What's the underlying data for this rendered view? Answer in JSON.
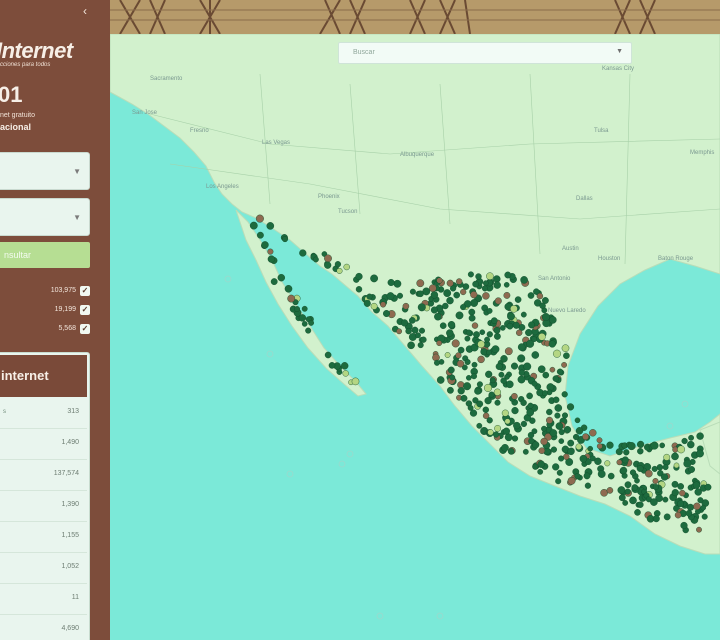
{
  "sidebar": {
    "collapse_icon": "chevron-left-icon",
    "logo_text": "Internet",
    "tagline": "cciones para todos",
    "stat_number": "01",
    "stat_line1": "net gratuito",
    "stat_line2": "acional",
    "button_label": "nsultar",
    "legend": [
      {
        "count": "103,975"
      },
      {
        "count": "19,199"
      },
      {
        "count": "5,568"
      }
    ],
    "panel": {
      "title": "internet",
      "rows": [
        {
          "label": "s",
          "value": "313"
        },
        {
          "label": "",
          "value": "1,490"
        },
        {
          "label": "",
          "value": "137,574"
        },
        {
          "label": "",
          "value": "1,390"
        },
        {
          "label": "",
          "value": "1,155"
        },
        {
          "label": "",
          "value": "1,052"
        },
        {
          "label": "",
          "value": "11"
        },
        {
          "label": "",
          "value": "4,690"
        }
      ]
    }
  },
  "map": {
    "search_placeholder": "Buscar",
    "places": [
      {
        "name": "Kansas City"
      },
      {
        "name": "Sacramento"
      },
      {
        "name": "San Jose"
      },
      {
        "name": "Fresno"
      },
      {
        "name": "Las Vegas"
      },
      {
        "name": "Albuquerque"
      },
      {
        "name": "Tulsa"
      },
      {
        "name": "Memphis"
      },
      {
        "name": "Los Angeles"
      },
      {
        "name": "Phoenix"
      },
      {
        "name": "Tucson"
      },
      {
        "name": "Dallas"
      },
      {
        "name": "Austin"
      },
      {
        "name": "Houston"
      },
      {
        "name": "Baton Rouge"
      },
      {
        "name": "San Antonio"
      },
      {
        "name": "Nuevo Laredo"
      }
    ]
  },
  "colors": {
    "sidebar": "#7d4d3b",
    "water": "#7be9d8",
    "land": "#d2f1cd",
    "marker_primary": "#1d6b3e",
    "marker_secondary": "#8e6a50",
    "marker_tertiary": "#b4d683"
  }
}
